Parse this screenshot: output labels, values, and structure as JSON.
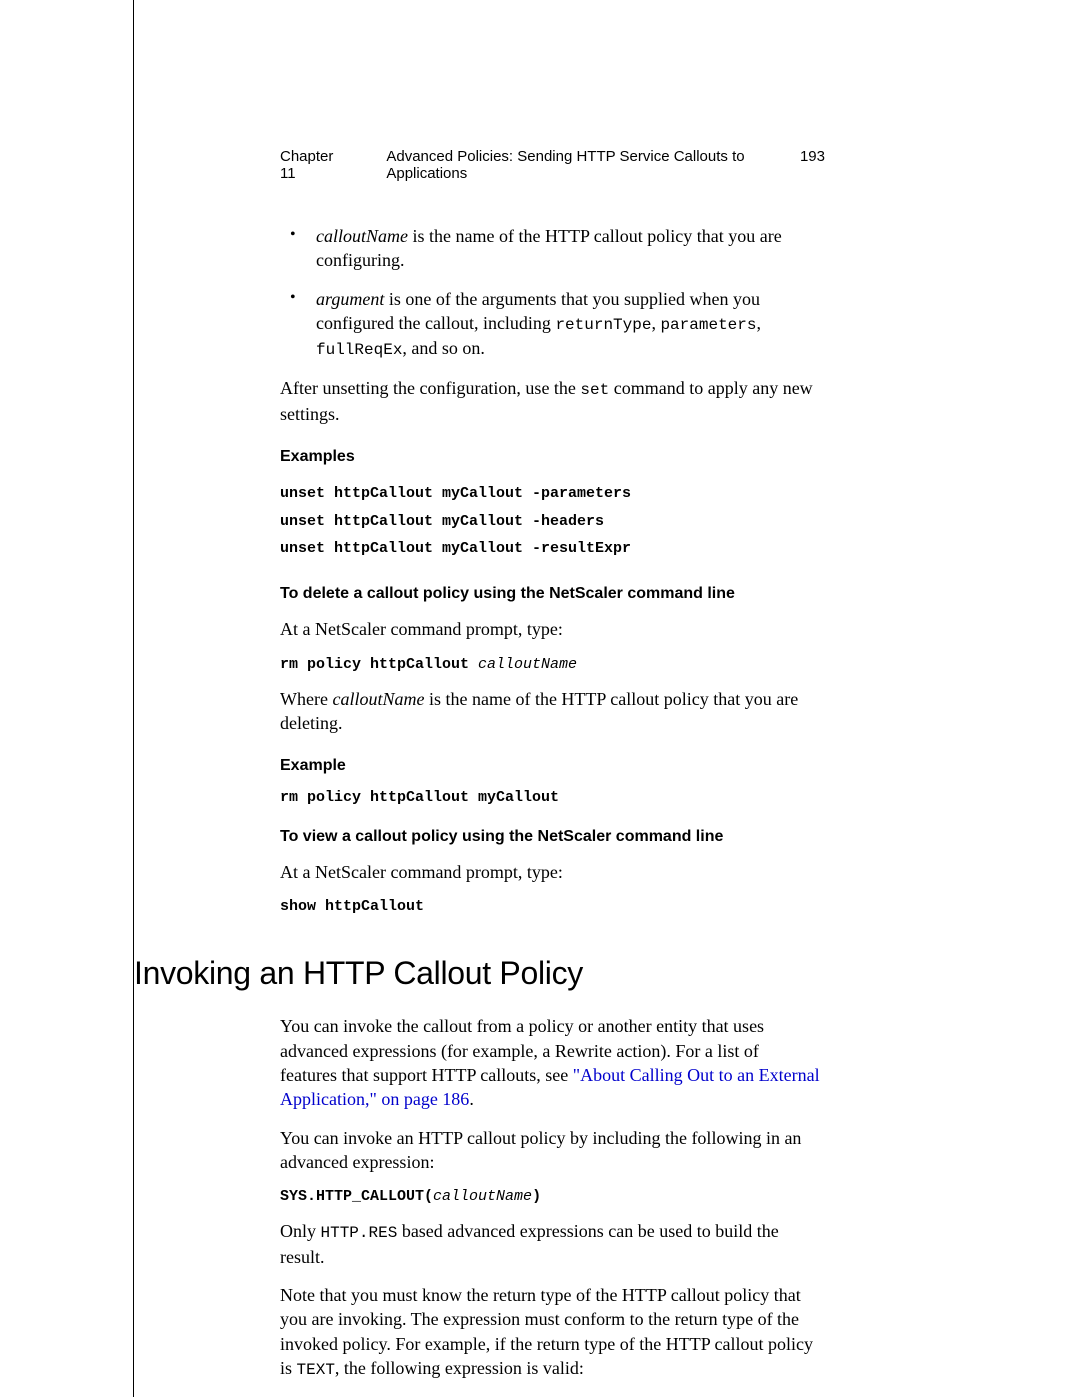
{
  "header": {
    "chapter": "Chapter 11",
    "title": "Advanced Policies: Sending HTTP Service Callouts to Applications",
    "page": "193"
  },
  "bullets": [
    {
      "term": "calloutName",
      "rest": " is the name of the HTTP callout policy that you are configuring."
    },
    {
      "term": "argument",
      "rest_prefix": " is one of the arguments that you supplied when you configured the callout, including ",
      "code1": "returnType",
      "c1": ", ",
      "code2": "parameters",
      "c2": ", ",
      "code3": "fullReqEx",
      "rest_suffix": ", and so on."
    }
  ],
  "after_unset_prefix": "After unsetting the configuration, use the ",
  "after_unset_code": "set",
  "after_unset_suffix": " command to apply any new settings.",
  "examples_heading": "Examples",
  "examples_code": {
    "l1": "unset httpCallout myCallout -parameters",
    "l2": "unset httpCallout myCallout -headers",
    "l3": "unset httpCallout myCallout -resultExpr"
  },
  "delete_heading": "To delete a callout policy using the NetScaler command line",
  "at_prompt": "At a NetScaler command prompt, type:",
  "rm_cmd_prefix": "rm policy httpCallout ",
  "rm_cmd_arg": "calloutName",
  "where_prefix": "Where ",
  "where_term": "calloutName",
  "where_suffix": " is the name of the HTTP callout policy that you are deleting.",
  "example_heading": "Example",
  "rm_example": "rm policy httpCallout myCallout",
  "view_heading": "To view a callout policy using the NetScaler command line",
  "show_cmd": "show httpCallout",
  "section_title": "Invoking an HTTP Callout Policy",
  "invoke_p1_prefix": "You can invoke the callout from a policy or another entity that uses advanced expressions (for example, a Rewrite action). For a list of features that support HTTP callouts, see ",
  "invoke_p1_link": "\"About Calling Out to an External Application,\" on page 186",
  "invoke_p1_suffix": ".",
  "invoke_p2": "You can invoke an HTTP callout policy by including the following in an advanced expression:",
  "sys_cmd_prefix": "SYS.HTTP_CALLOUT(",
  "sys_cmd_arg": "calloutName",
  "sys_cmd_suffix": ")",
  "only_prefix": "Only ",
  "only_code": "HTTP.RES",
  "only_suffix": " based advanced expressions can be used to build the result.",
  "note_prefix": "Note that you must know the return type of the HTTP callout policy that you are invoking. The expression must conform to the return type of the invoked policy. For example, if the return type of the HTTP callout policy is ",
  "note_code": "TEXT",
  "note_suffix": ", the following expression is valid:"
}
